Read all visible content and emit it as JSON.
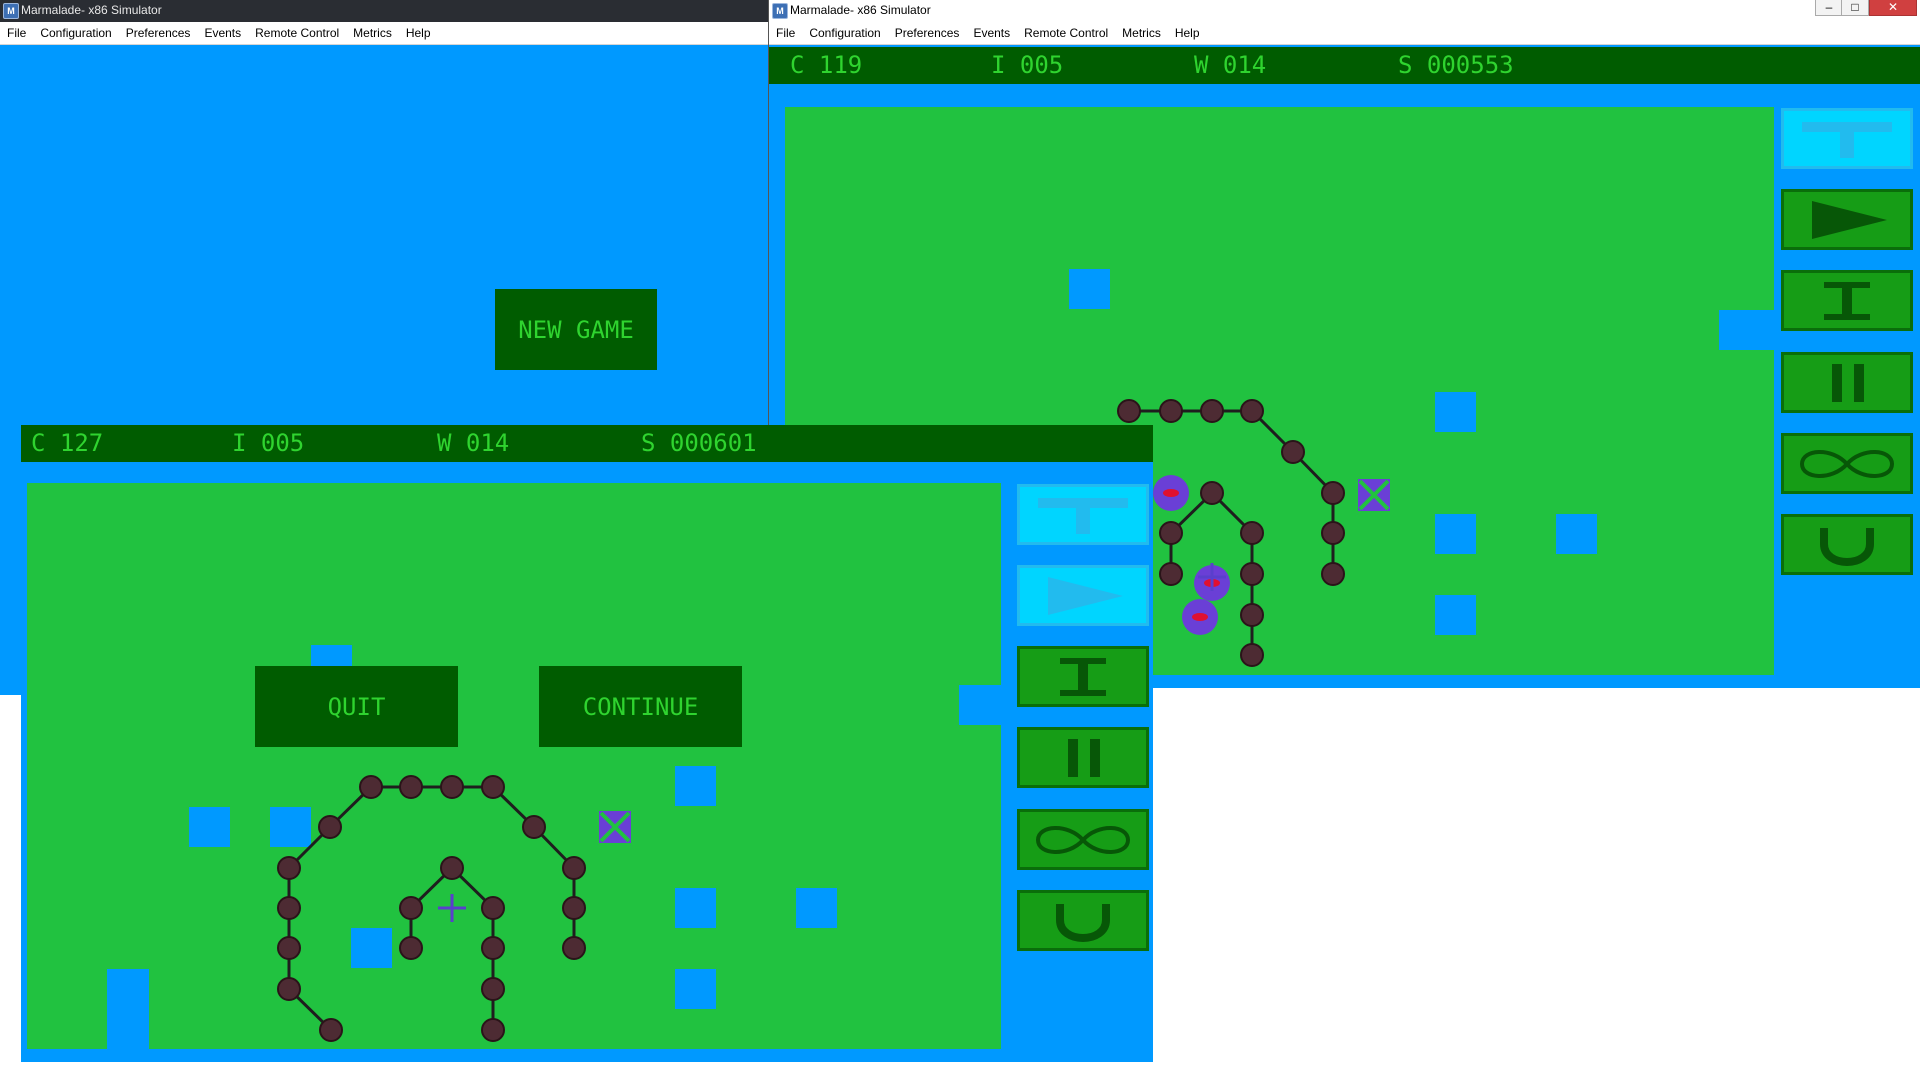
{
  "simulator": {
    "title": "Marmalade- x86 Simulator",
    "icon_letter": "M",
    "menu": [
      "File",
      "Configuration",
      "Preferences",
      "Events",
      "Remote Control",
      "Metrics",
      "Help"
    ]
  },
  "window_title_controls": {
    "minimize": "–",
    "maximize": "□",
    "close": "✕"
  },
  "menu_screen": {
    "new_game_label": "NEW GAME"
  },
  "game_right": {
    "hud": {
      "c": "C 119",
      "i": "I 005",
      "w": "W 014",
      "s": "S 000553"
    },
    "toolbar": [
      "tower-icon",
      "play-icon",
      "tower-i-icon",
      "pause-icon",
      "infinity-icon",
      "magnet-icon"
    ],
    "active_tool": "tower-icon"
  },
  "game_front": {
    "hud": {
      "c": "C 127",
      "i": "I 005",
      "w": "W 014",
      "s": "S 000601"
    },
    "quit_label": "QUIT",
    "continue_label": "CONTINUE",
    "toolbar": [
      "tower-icon",
      "play-icon",
      "tower-i-icon",
      "pause-icon",
      "infinity-icon",
      "magnet-icon"
    ],
    "active_tools": [
      "tower-icon",
      "play-icon"
    ]
  },
  "colors": {
    "background_blue": "#0099ff",
    "field_green": "#21c240",
    "hud_dark": "#005c00",
    "hud_text": "#2fd42f",
    "active_button": "#00d5ff",
    "node": "#4d2b33",
    "enemy": "#6a3fd6"
  }
}
